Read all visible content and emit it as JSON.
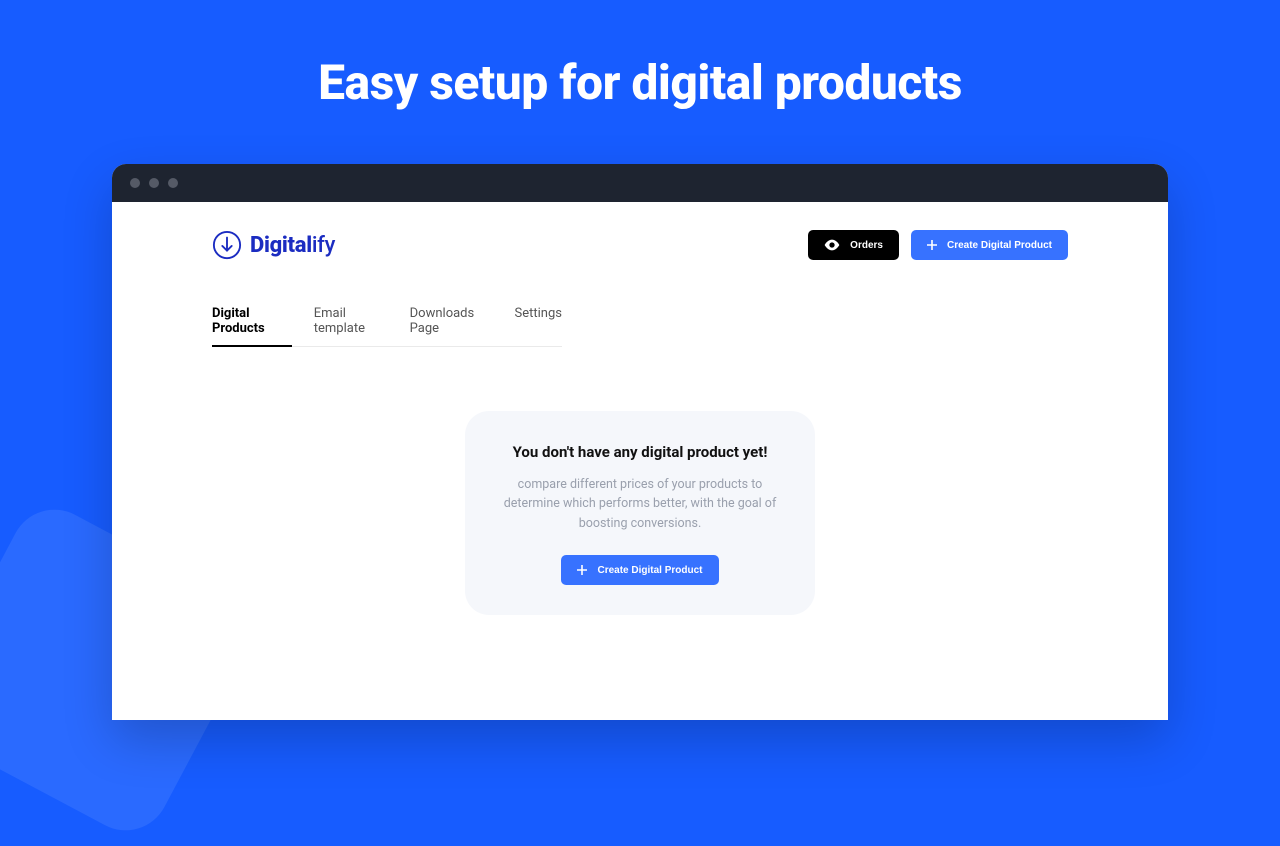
{
  "hero": {
    "title": "Easy setup for digital products"
  },
  "logo": {
    "bold": "Digital",
    "light": "ify"
  },
  "header": {
    "orders_label": "Orders",
    "create_label": "Create Digital Product"
  },
  "tabs": [
    {
      "label": "Digital Products",
      "active": true
    },
    {
      "label": "Email template",
      "active": false
    },
    {
      "label": "Downloads Page",
      "active": false
    },
    {
      "label": "Settings",
      "active": false
    }
  ],
  "empty_state": {
    "title": "You don't have any digital product yet!",
    "body": "compare different prices of your products to determine which performs better, with the goal of boosting conversions.",
    "cta_label": "Create Digital Product"
  },
  "colors": {
    "background": "#175CFF",
    "primary": "#3772FF",
    "logo": "#1B2CC1"
  }
}
